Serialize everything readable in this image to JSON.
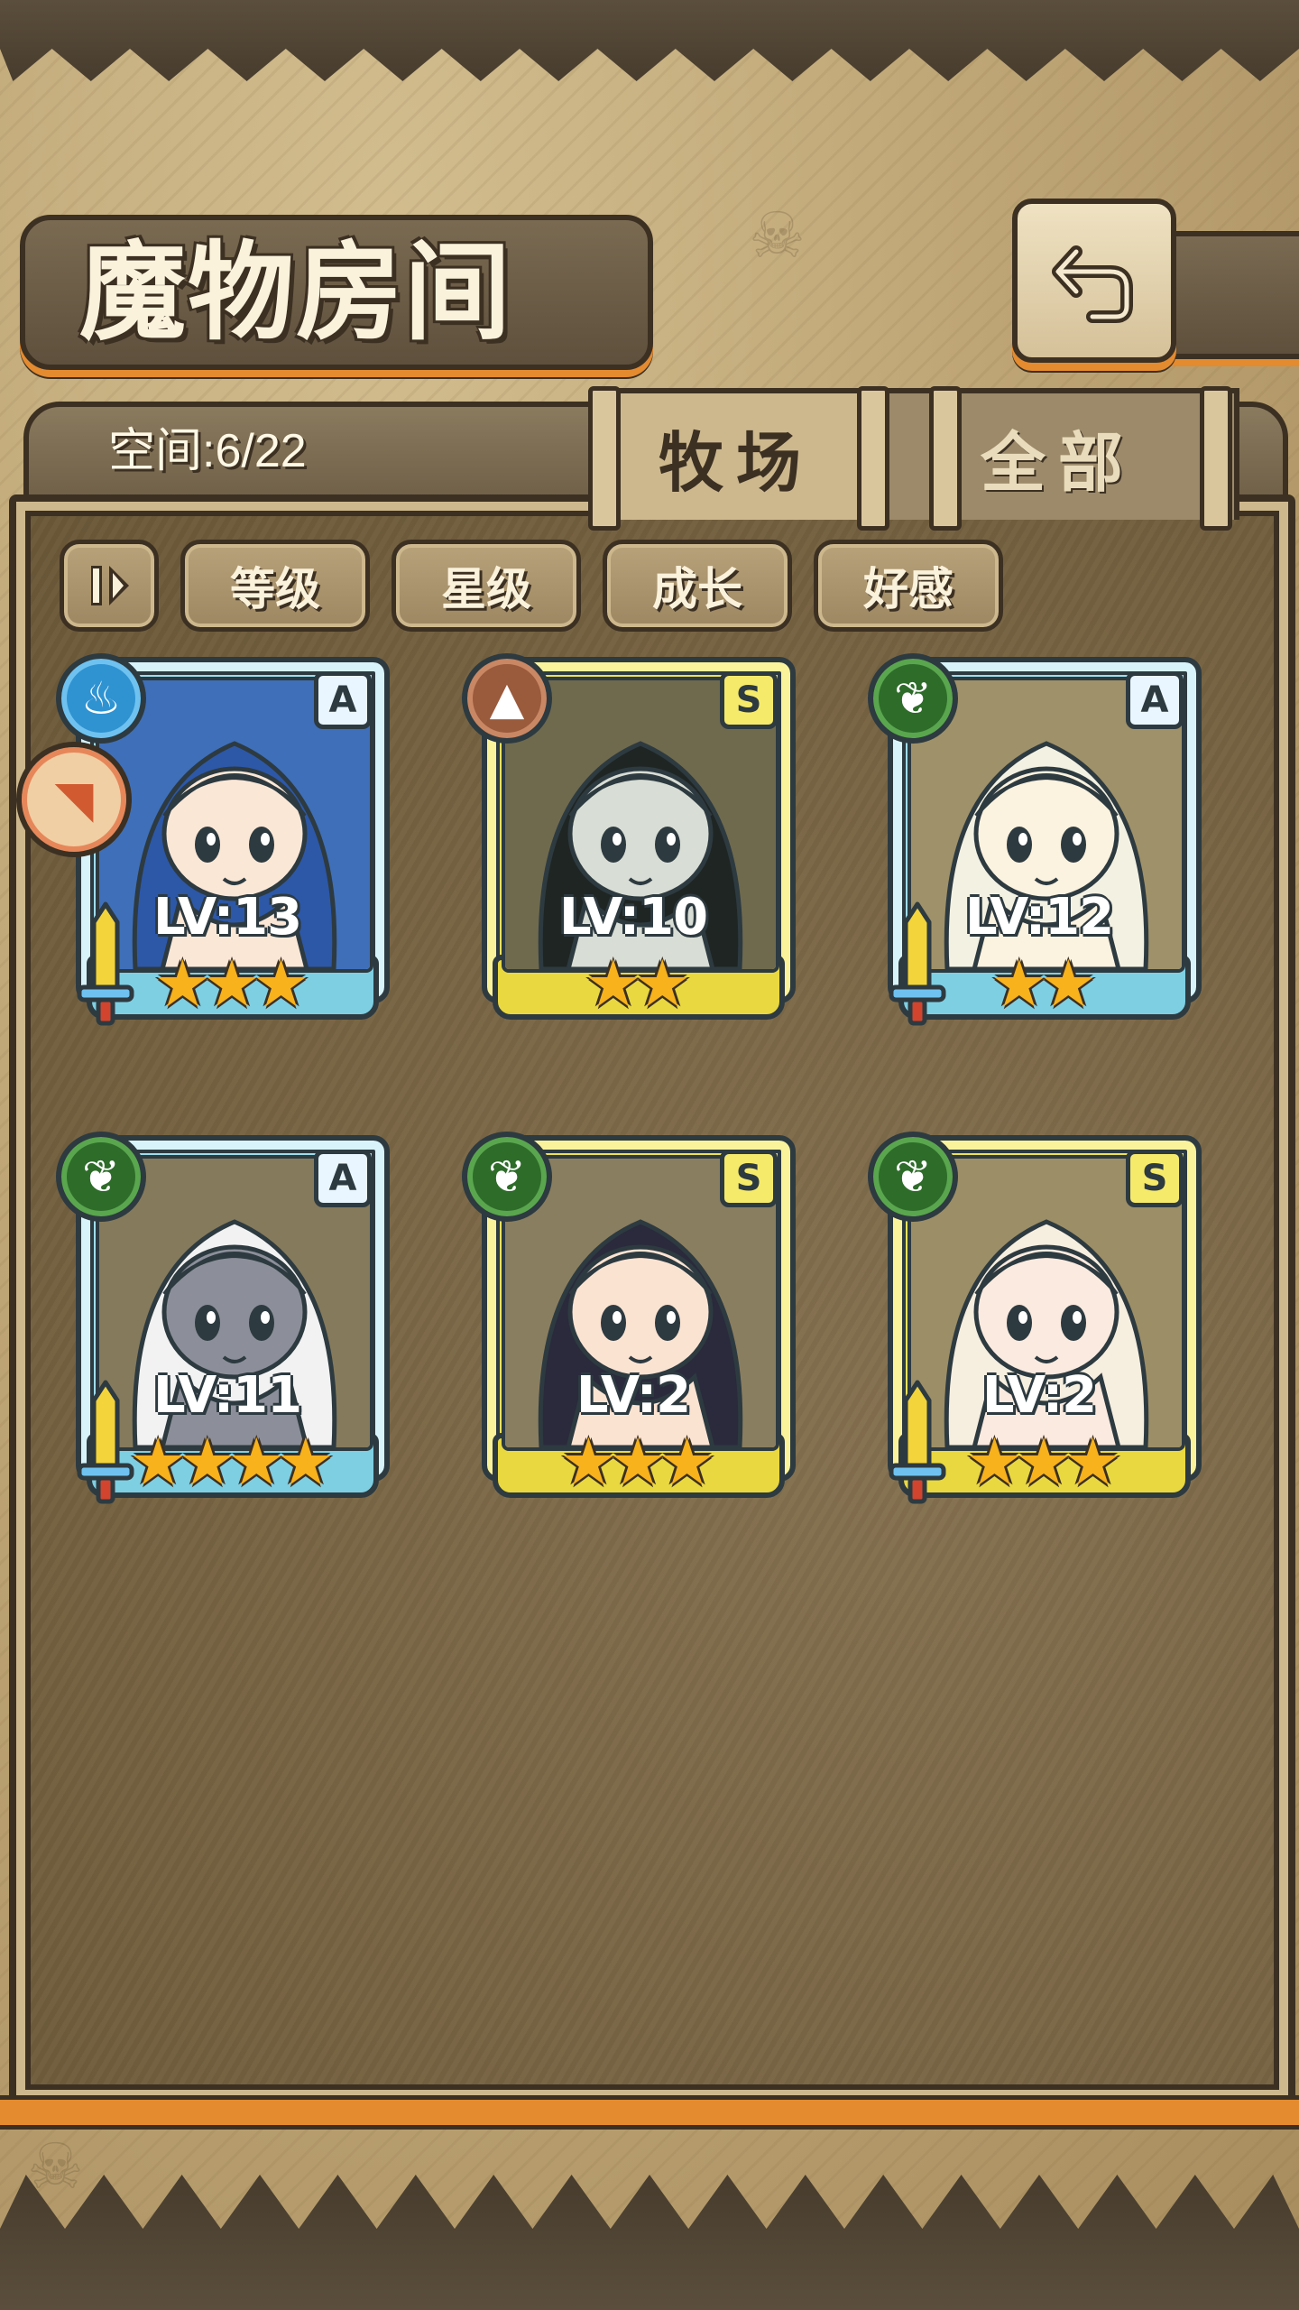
{
  "header": {
    "title": "魔物房间",
    "back_icon": "back-return-icon"
  },
  "panel": {
    "capacity_label": "空间:6/22",
    "tabs": [
      {
        "label": "牧场",
        "active": true
      },
      {
        "label": "全部",
        "active": false
      }
    ],
    "sort_buttons": [
      "等级",
      "星级",
      "成长",
      "好感"
    ],
    "order_icon": "sort-order-icon"
  },
  "monsters": [
    {
      "rank": "A",
      "frame": "cyan",
      "element": "water",
      "level": "LV:13",
      "stars": "★★★",
      "star_count": 3,
      "equipped": true,
      "hair": "#2d58a8",
      "skin": "#fbe7d6",
      "bg": "#3f6fb8"
    },
    {
      "rank": "S",
      "frame": "gold",
      "element": "earth",
      "level": "LV:10",
      "stars": "★★",
      "star_count": 2,
      "equipped": false,
      "hair": "#1f2523",
      "skin": "#d8ddd5",
      "bg": "#6f6a4e"
    },
    {
      "rank": "A",
      "frame": "cyan",
      "element": "nature",
      "level": "LV:12",
      "stars": "★★",
      "star_count": 2,
      "equipped": true,
      "hair": "#f3f1e2",
      "skin": "#fbf2df",
      "bg": "#9f9169"
    },
    {
      "rank": "A",
      "frame": "cyan",
      "element": "nature",
      "level": "LV:11",
      "stars": "★★★★",
      "star_count": 4,
      "equipped": true,
      "hair": "#f2f2f2",
      "skin": "#8c8f99",
      "bg": "#857a5c"
    },
    {
      "rank": "S",
      "frame": "gold",
      "element": "nature",
      "level": "LV:2",
      "stars": "★★★",
      "star_count": 3,
      "equipped": false,
      "hair": "#2a2a3c",
      "skin": "#fbe3d2",
      "bg": "#8a7e60"
    },
    {
      "rank": "S",
      "frame": "gold",
      "element": "nature",
      "level": "LV:2",
      "stars": "★★★",
      "star_count": 3,
      "equipped": true,
      "hair": "#f6eedf",
      "skin": "#fbeadf",
      "bg": "#9c8e66"
    }
  ],
  "colors": {
    "accent_orange": "#e48a2f",
    "frame_cyan": "#9fdcec",
    "frame_gold": "#ece15a",
    "star": "#f7b21c"
  }
}
